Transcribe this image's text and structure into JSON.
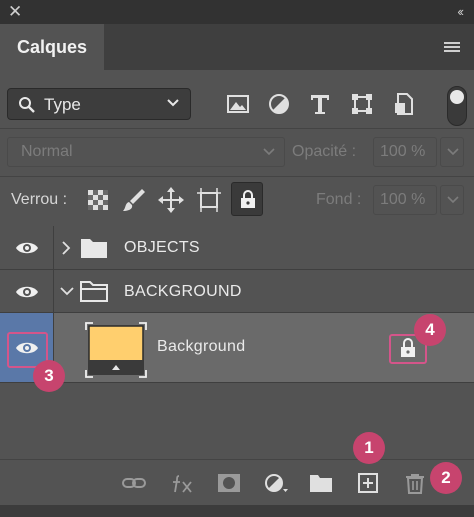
{
  "window": {
    "close_glyph": "✕",
    "collapse_glyph": "‹‹"
  },
  "panel": {
    "tab_label": "Calques"
  },
  "filter": {
    "kind_label": "Type",
    "icons": [
      "image-filter-icon",
      "adjustment-filter-icon",
      "type-filter-icon",
      "shape-filter-icon",
      "smart-object-filter-icon"
    ]
  },
  "blend": {
    "mode": "Normal",
    "opacity_label": "Opacité :",
    "opacity_value": "100 %"
  },
  "lock": {
    "label": "Verrou :",
    "fill_label": "Fond :",
    "fill_value": "100 %"
  },
  "layers": [
    {
      "name": "OBJECTS",
      "type": "group",
      "expanded": false
    },
    {
      "name": "BACKGROUND",
      "type": "group",
      "expanded": true
    },
    {
      "name": "Background",
      "type": "layer",
      "selected": true,
      "locked": true
    }
  ],
  "badges": {
    "b1": "1",
    "b2": "2",
    "b3": "3",
    "b4": "4"
  },
  "colors": {
    "accent": "#c7446e",
    "selection": "#5a78a8",
    "thumb_fill": "#ffcf6e"
  }
}
